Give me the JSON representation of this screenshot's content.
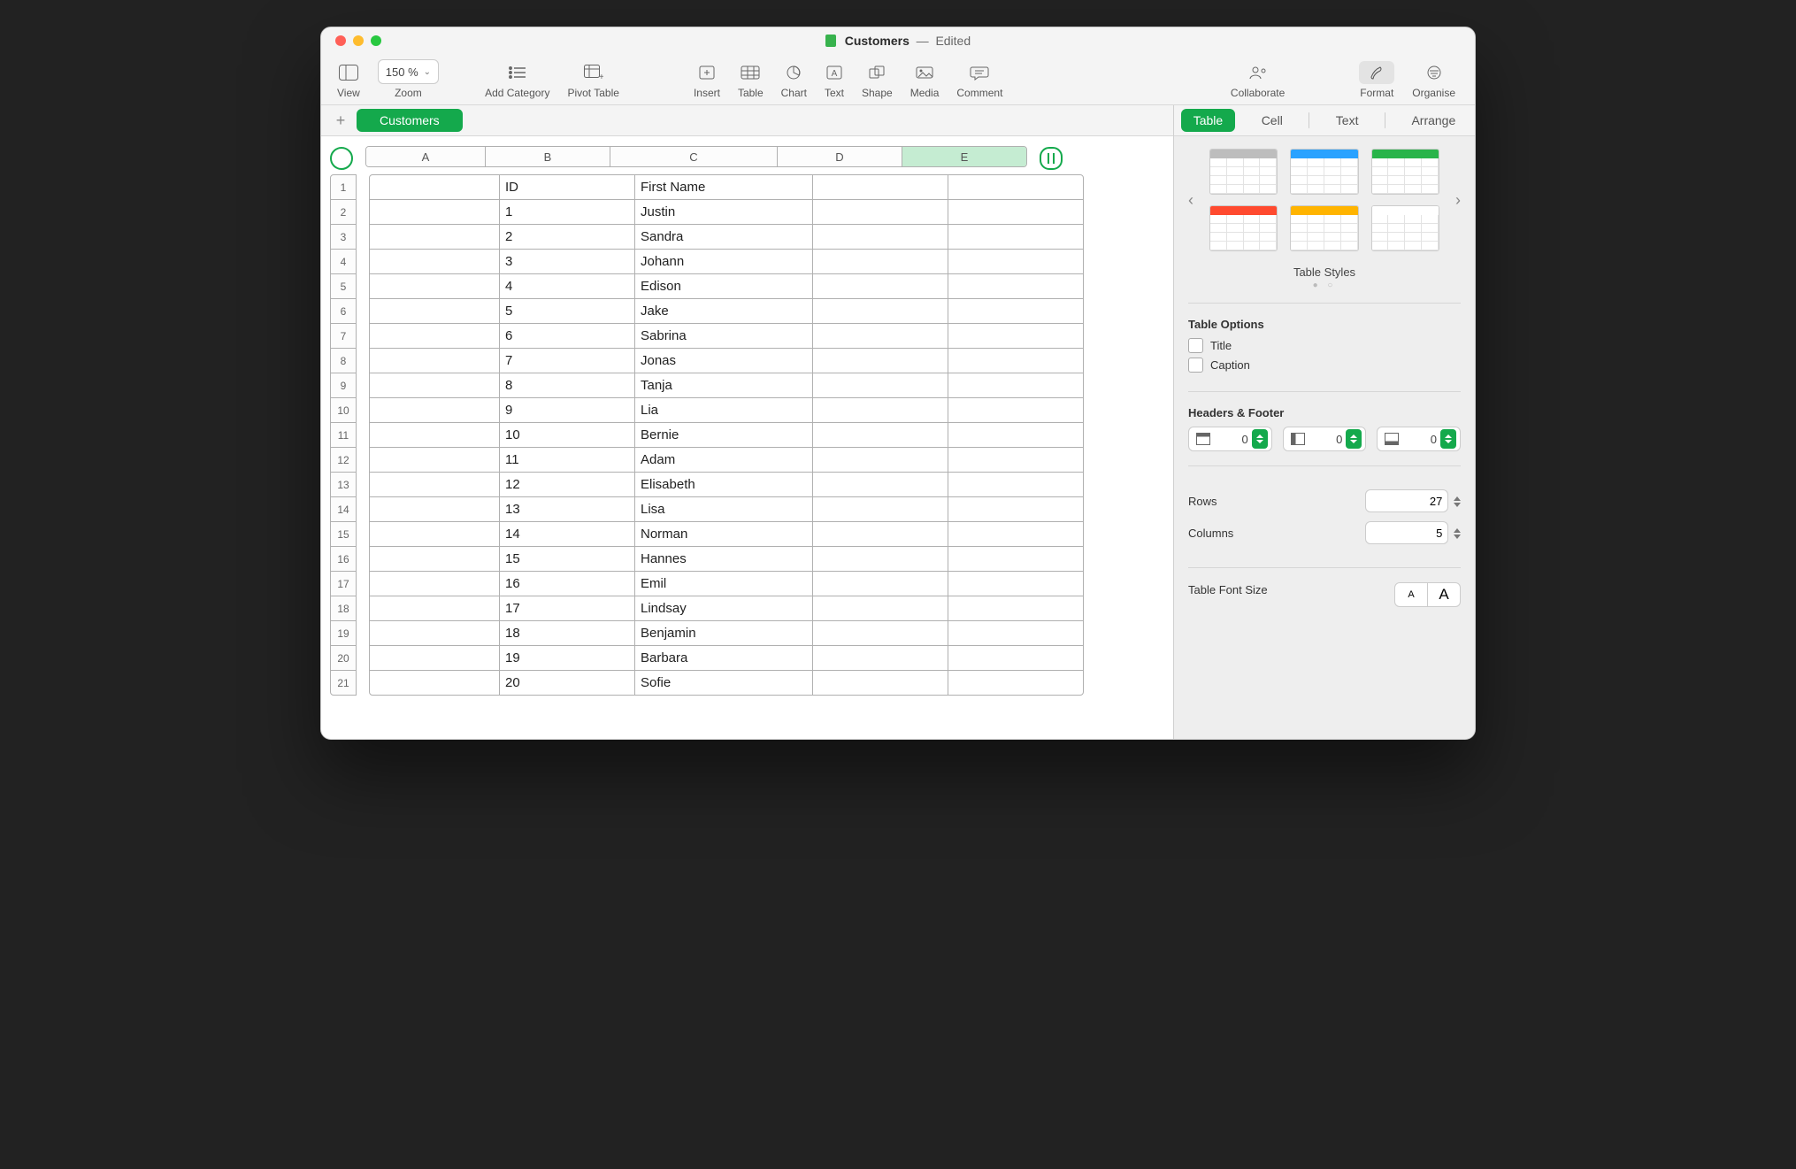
{
  "titlebar": {
    "document": "Customers",
    "status": "Edited"
  },
  "toolbar": {
    "view": "View",
    "zoom_value": "150 %",
    "zoom": "Zoom",
    "add_category": "Add Category",
    "pivot": "Pivot Table",
    "insert": "Insert",
    "table": "Table",
    "chart": "Chart",
    "text": "Text",
    "shape": "Shape",
    "media": "Media",
    "comment": "Comment",
    "collaborate": "Collaborate",
    "format": "Format",
    "organise": "Organise"
  },
  "sheets": {
    "active": "Customers"
  },
  "side_tabs": {
    "table": "Table",
    "cell": "Cell",
    "text": "Text",
    "arrange": "Arrange"
  },
  "columns": [
    "A",
    "B",
    "C",
    "D",
    "E"
  ],
  "rows": [
    {
      "n": "1",
      "B": "ID",
      "C": "First Name"
    },
    {
      "n": "2",
      "B": "1",
      "C": "Justin"
    },
    {
      "n": "3",
      "B": "2",
      "C": "Sandra"
    },
    {
      "n": "4",
      "B": "3",
      "C": "Johann"
    },
    {
      "n": "5",
      "B": "4",
      "C": "Edison"
    },
    {
      "n": "6",
      "B": "5",
      "C": "Jake"
    },
    {
      "n": "7",
      "B": "6",
      "C": "Sabrina"
    },
    {
      "n": "8",
      "B": "7",
      "C": "Jonas"
    },
    {
      "n": "9",
      "B": "8",
      "C": "Tanja"
    },
    {
      "n": "10",
      "B": "9",
      "C": "Lia"
    },
    {
      "n": "11",
      "B": "10",
      "C": "Bernie"
    },
    {
      "n": "12",
      "B": "11",
      "C": "Adam"
    },
    {
      "n": "13",
      "B": "12",
      "C": "Elisabeth"
    },
    {
      "n": "14",
      "B": "13",
      "C": "Lisa"
    },
    {
      "n": "15",
      "B": "14",
      "C": "Norman"
    },
    {
      "n": "16",
      "B": "15",
      "C": "Hannes"
    },
    {
      "n": "17",
      "B": "16",
      "C": "Emil"
    },
    {
      "n": "18",
      "B": "17",
      "C": "Lindsay"
    },
    {
      "n": "19",
      "B": "18",
      "C": "Benjamin"
    },
    {
      "n": "20",
      "B": "19",
      "C": "Barbara"
    },
    {
      "n": "21",
      "B": "20",
      "C": "Sofie"
    }
  ],
  "sidebar": {
    "styles_label": "Table Styles",
    "options_label": "Table Options",
    "opt_title": "Title",
    "opt_caption": "Caption",
    "hf_label": "Headers & Footer",
    "hf_vals": {
      "header_rows": "0",
      "header_cols": "0",
      "footer_rows": "0"
    },
    "rows_label": "Rows",
    "rows_val": "27",
    "cols_label": "Columns",
    "cols_val": "5",
    "font_label": "Table Font Size",
    "font_small": "A",
    "font_large": "A",
    "style_colors": [
      "#bdbdbd",
      "#2aa2ff",
      "#29b44a",
      "#ff4a2f",
      "#ffb400",
      "#ffffff"
    ]
  }
}
